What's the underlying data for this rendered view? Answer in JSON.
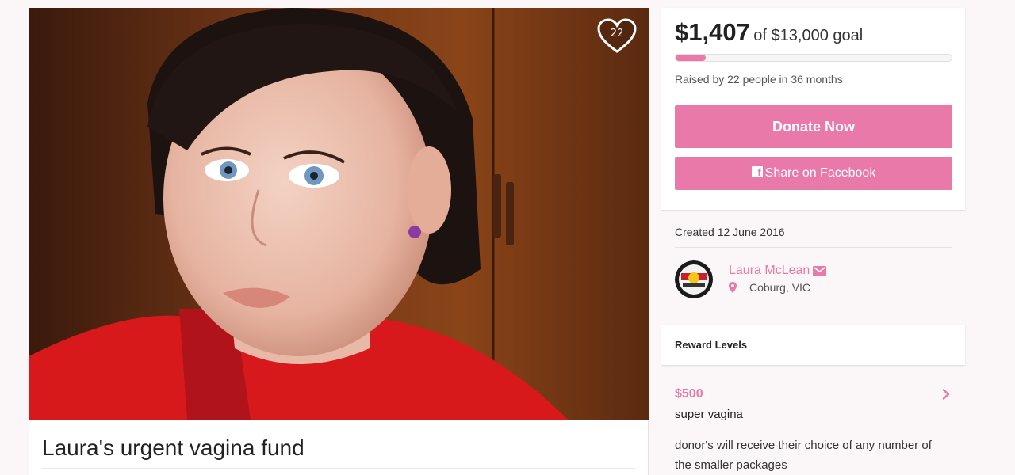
{
  "campaign": {
    "title": "Laura's urgent vagina fund",
    "likes_count": "22",
    "created": "Created 12 June 2016"
  },
  "funding": {
    "raised": "$1,407",
    "goal": "of $13,000 goal",
    "raised_by": "Raised by 22 people in 36 months",
    "progress_fraction": 0.108
  },
  "actions": {
    "donate_label": "Donate Now",
    "share_label": "Share on Facebook"
  },
  "organizer": {
    "name": "Laura McLean",
    "location": "Coburg, VIC"
  },
  "rewards": {
    "heading": "Reward Levels",
    "items": [
      {
        "amount": "$500",
        "name": "super vagina",
        "description": "donor's will receive their choice of any number of the smaller packages"
      }
    ]
  },
  "colors": {
    "accent": "#e879a8",
    "background": "#fbf7f9"
  },
  "icons": [
    "heart-icon",
    "facebook-icon",
    "envelope-icon",
    "map-pin-icon",
    "chevron-right-icon"
  ]
}
